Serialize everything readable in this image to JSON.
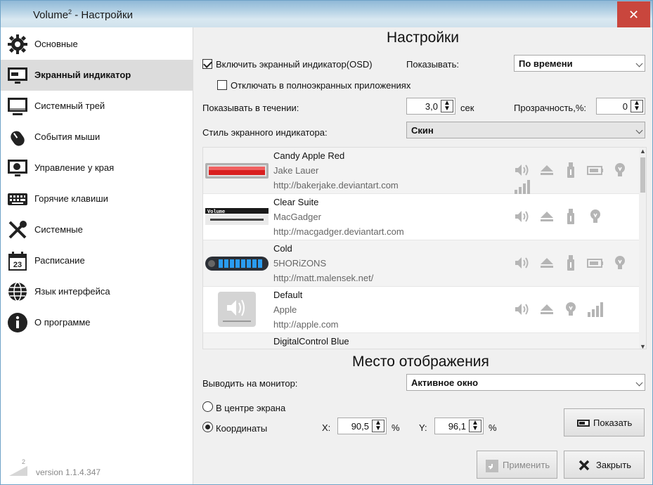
{
  "window": {
    "title": "Volume",
    "title_sup": "2",
    "title_rest": " - Настройки",
    "close": "✕"
  },
  "sidebar": {
    "items": [
      {
        "label": "Основные",
        "icon": "gear-icon"
      },
      {
        "label": "Экранный индикатор",
        "icon": "monitor-icon"
      },
      {
        "label": "Системный трей",
        "icon": "tray-icon"
      },
      {
        "label": "События мыши",
        "icon": "mouse-icon"
      },
      {
        "label": "Управление у края",
        "icon": "edge-icon"
      },
      {
        "label": "Горячие клавиши",
        "icon": "keyboard-icon"
      },
      {
        "label": "Системные",
        "icon": "tools-icon"
      },
      {
        "label": "Расписание",
        "icon": "calendar-icon"
      },
      {
        "label": "Язык интерфейса",
        "icon": "globe-icon"
      },
      {
        "label": "О программе",
        "icon": "info-icon"
      }
    ],
    "calendar_day": "23",
    "version": "version 1.1.4.347",
    "logo_sup": "2"
  },
  "settings": {
    "title": "Настройки",
    "osd_enable_label": "Включить экранный индикатор(OSD)",
    "osd_enable_checked": true,
    "show_label": "Показывать:",
    "show_value": "По времени",
    "fullscreen_label": "Отключать в полноэкранных приложениях",
    "fullscreen_checked": false,
    "duration_label": "Показывать в течении:",
    "duration_value": "3,0",
    "duration_unit": "сек",
    "opacity_label": "Прозрачность,%:",
    "opacity_value": "0",
    "style_label": "Стиль экранного индикатора:",
    "style_value": "Скин"
  },
  "skins": [
    {
      "name": "Candy Apple Red",
      "author": "Jake Lauer",
      "url": "http://bakerjake.deviantart.com",
      "icons": [
        "speaker-icon",
        "eject-icon",
        "usb-icon",
        "battery-icon",
        "bulb-icon",
        "signal-bars-icon"
      ]
    },
    {
      "name": "Clear Suite",
      "author": "MacGadger",
      "url": "http://macgadger.deviantart.com",
      "icons": [
        "speaker-icon",
        "eject-icon",
        "usb-icon",
        "bulb-icon"
      ],
      "thumb_text": "Volume"
    },
    {
      "name": "Cold",
      "author": "5HORiZONS",
      "url": "http://matt.malensek.net/",
      "icons": [
        "speaker-icon",
        "eject-icon",
        "usb-icon",
        "battery-icon",
        "bulb-icon"
      ]
    },
    {
      "name": "Default",
      "author": "Apple",
      "url": "http://apple.com",
      "icons": [
        "speaker-icon",
        "eject-icon",
        "bulb-icon",
        "signal-bars-icon"
      ]
    },
    {
      "name": "DigitalControl Blue",
      "author": "",
      "url": "",
      "icons": []
    }
  ],
  "placement": {
    "title": "Место отображения",
    "monitor_label": "Выводить на монитор:",
    "monitor_value": "Активное окно",
    "center_label": "В центре экрана",
    "center_selected": false,
    "coords_label": "Координаты",
    "coords_selected": true,
    "x_label": "X:",
    "x_value": "90,5",
    "y_label": "Y:",
    "y_value": "96,1",
    "percent": "%",
    "show_button": "Показать"
  },
  "footer": {
    "apply_button": "Применить",
    "close_button": "Закрыть"
  },
  "colors": {
    "title_gradient": "#8fb8d6",
    "close_red": "#c9463d",
    "selected_bg": "#dcdcdc",
    "candy_red": "#d91f1f",
    "cold_blue": "#2a9cf0"
  }
}
